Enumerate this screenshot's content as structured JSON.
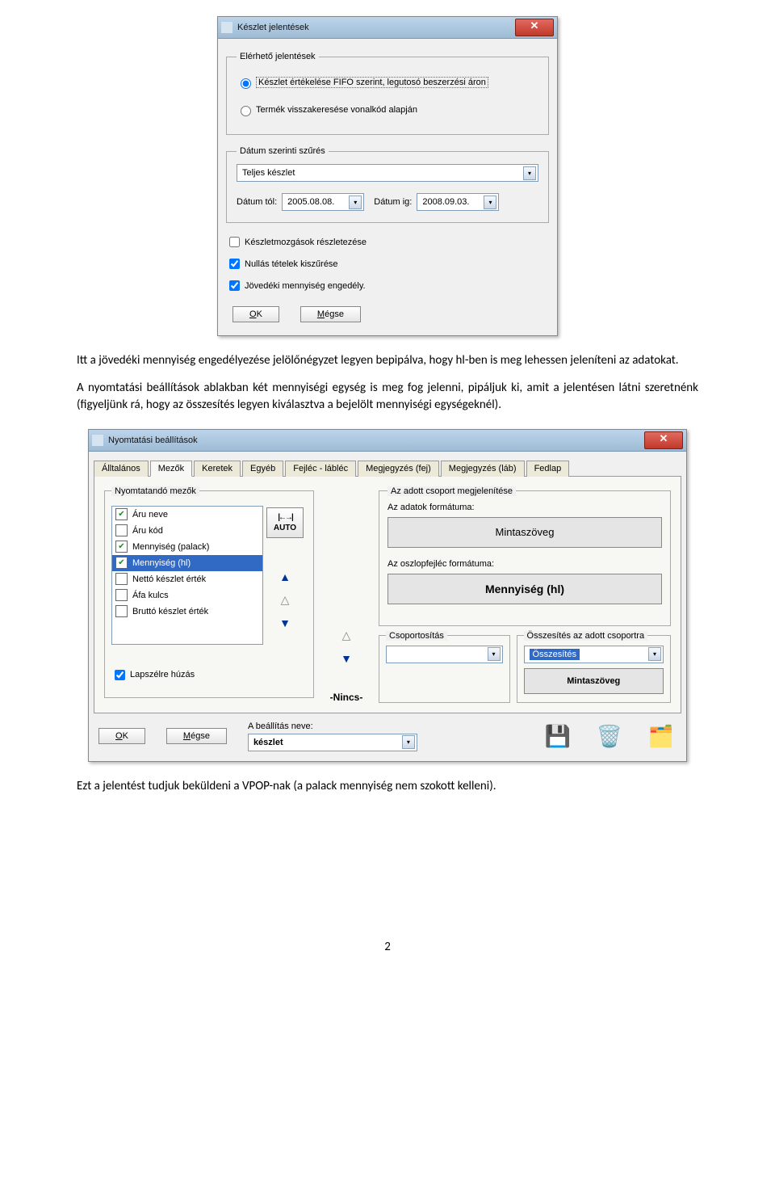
{
  "dialog1": {
    "title": "Készlet jelentések",
    "sections": {
      "reports": {
        "legend": "Elérhető jelentések",
        "opt1": "Készlet értékelése FIFO szerint, legutosó beszerzési áron",
        "opt2": "Termék visszakeresése vonalkód alapján"
      },
      "datefilter": {
        "legend": "Dátum szerinti szűrés",
        "scope": "Teljes készlet",
        "from_label": "Dátum tól:",
        "from_value": "2005.08.08.",
        "to_label": "Dátum ig:",
        "to_value": "2008.09.03."
      },
      "checks": {
        "detail": "Készletmozgások részletezése",
        "nullfilter": "Nullás tételek kiszűrése",
        "excise": "Jövedéki mennyiség engedély."
      }
    },
    "buttons": {
      "ok": "OK",
      "cancel": "Mégse"
    }
  },
  "para1": "Itt a jövedéki mennyiség engedélyezése jelölőnégyzet legyen bepipálva, hogy hl-ben is meg lehessen jeleníteni az adatokat.",
  "para2": "A nyomtatási beállítások ablakban két mennyiségi egység is meg fog jelenni, pipáljuk ki, amit a jelentésen látni szeretnénk (figyeljünk rá, hogy az összesítés legyen kiválasztva a bejelölt mennyiségi egységeknél).",
  "dialog2": {
    "title": "Nyomtatási beállítások",
    "tabs": [
      "Álltalános",
      "Mezők",
      "Keretek",
      "Egyéb",
      "Fejléc - lábléc",
      "Megjegyzés (fej)",
      "Megjegyzés (láb)",
      "Fedlap"
    ],
    "active_tab": 1,
    "fields": {
      "legend": "Nyomtatandó mezők",
      "rows": [
        {
          "checked": true,
          "label": "Áru neve"
        },
        {
          "checked": false,
          "label": "Áru kód"
        },
        {
          "checked": true,
          "label": "Mennyiség (palack)"
        },
        {
          "checked": true,
          "label": "Mennyiség (hl)",
          "selected": true
        },
        {
          "checked": false,
          "label": "Nettó készlet érték"
        },
        {
          "checked": false,
          "label": "Áfa kulcs"
        },
        {
          "checked": false,
          "label": "Bruttó készlet érték"
        }
      ],
      "auto": "AUTO",
      "edge_check": "Lapszélre húzás",
      "nincs": "-Nincs-"
    },
    "right": {
      "group_show": "Az adott csoport megjelenítése",
      "format_label": "Az adatok formátuma:",
      "sample": "Mintaszöveg",
      "header_format": "Az oszlopfejléc formátuma:",
      "col_label": "Mennyiség (hl)",
      "grouping_label": "Csoportosítás",
      "sum_label": "Összesítés az adott csoportra",
      "grouping_value": "",
      "sum_value": "Összesítés",
      "sample2": "Mintaszöveg"
    },
    "bottom": {
      "ok": "OK",
      "cancel": "Mégse",
      "setting_label": "A beállítás neve:",
      "setting_value": "készlet"
    }
  },
  "para3": "Ezt a jelentést tudjuk beküldeni a VPOP-nak (a palack mennyiség nem szokott kelleni).",
  "page_num": "2"
}
